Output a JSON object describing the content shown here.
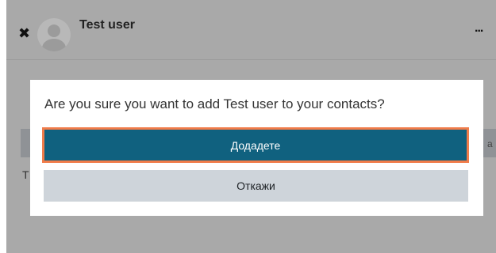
{
  "header": {
    "close_icon": "close-icon",
    "user_name": "Test user",
    "more_label": "..."
  },
  "background": {
    "right_char": "a",
    "left_char": "T"
  },
  "dialog": {
    "question": "Are you sure you want to add Test user to your contacts?",
    "confirm_label": "Додадете",
    "cancel_label": "Откажи"
  },
  "colors": {
    "overlay": "#a9a9a9",
    "primary_button": "#10617f",
    "focus_ring": "#f07c4a",
    "secondary_button": "#ced4da"
  }
}
